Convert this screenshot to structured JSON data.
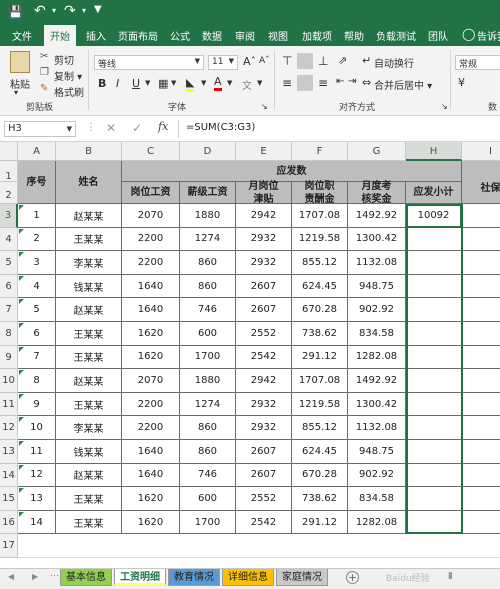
{
  "tabs": [
    "文件",
    "开始",
    "插入",
    "页面布局",
    "公式",
    "数据",
    "审阅",
    "视图",
    "加载项",
    "帮助",
    "负载测试",
    "团队",
    "告诉我"
  ],
  "ribbon": {
    "paste": "粘贴",
    "cut": "剪切",
    "copy": "复制 ▾",
    "format_painter": "格式刷",
    "clipboard": "剪贴板",
    "font_name": "等线",
    "font_size": "11",
    "font_group": "字体",
    "wrap": "自动换行",
    "merge": "合并后居中 ▾",
    "align_group": "对齐方式",
    "number_format": "常规",
    "number_group": "数"
  },
  "namebox": "H3",
  "formula": "=SUM(C3:G3)",
  "columns": [
    "A",
    "B",
    "C",
    "D",
    "E",
    "F",
    "G",
    "H",
    "I"
  ],
  "header": {
    "group": "应发数",
    "seq": "序号",
    "name": "姓名",
    "c": "岗位工资",
    "d": "薪级工资",
    "e": [
      "月岗位",
      "津贴"
    ],
    "f": [
      "岗位职",
      "责酬金"
    ],
    "g": [
      "月度考",
      "核奖金"
    ],
    "h": "应发小计",
    "i": "社保"
  },
  "rows": [
    {
      "n": "1",
      "name": "赵某某",
      "c": "2070",
      "d": "1880",
      "e": "2942",
      "f": "1707.08",
      "g": "1492.92",
      "h": "10092"
    },
    {
      "n": "2",
      "name": "王某某",
      "c": "2200",
      "d": "1274",
      "e": "2932",
      "f": "1219.58",
      "g": "1300.42",
      "h": ""
    },
    {
      "n": "3",
      "name": "李某某",
      "c": "2200",
      "d": "860",
      "e": "2932",
      "f": "855.12",
      "g": "1132.08",
      "h": ""
    },
    {
      "n": "4",
      "name": "钱某某",
      "c": "1640",
      "d": "860",
      "e": "2607",
      "f": "624.45",
      "g": "948.75",
      "h": ""
    },
    {
      "n": "5",
      "name": "赵某某",
      "c": "1640",
      "d": "746",
      "e": "2607",
      "f": "670.28",
      "g": "902.92",
      "h": ""
    },
    {
      "n": "6",
      "name": "王某某",
      "c": "1620",
      "d": "600",
      "e": "2552",
      "f": "738.62",
      "g": "834.58",
      "h": ""
    },
    {
      "n": "7",
      "name": "王某某",
      "c": "1620",
      "d": "1700",
      "e": "2542",
      "f": "291.12",
      "g": "1282.08",
      "h": ""
    },
    {
      "n": "8",
      "name": "赵某某",
      "c": "2070",
      "d": "1880",
      "e": "2942",
      "f": "1707.08",
      "g": "1492.92",
      "h": ""
    },
    {
      "n": "9",
      "name": "王某某",
      "c": "2200",
      "d": "1274",
      "e": "2932",
      "f": "1219.58",
      "g": "1300.42",
      "h": ""
    },
    {
      "n": "10",
      "name": "李某某",
      "c": "2200",
      "d": "860",
      "e": "2932",
      "f": "855.12",
      "g": "1132.08",
      "h": ""
    },
    {
      "n": "11",
      "name": "钱某某",
      "c": "1640",
      "d": "860",
      "e": "2607",
      "f": "624.45",
      "g": "948.75",
      "h": ""
    },
    {
      "n": "12",
      "name": "赵某某",
      "c": "1640",
      "d": "746",
      "e": "2607",
      "f": "670.28",
      "g": "902.92",
      "h": ""
    },
    {
      "n": "13",
      "name": "王某某",
      "c": "1620",
      "d": "600",
      "e": "2552",
      "f": "738.62",
      "g": "834.58",
      "h": ""
    },
    {
      "n": "14",
      "name": "王某某",
      "c": "1620",
      "d": "1700",
      "e": "2542",
      "f": "291.12",
      "g": "1282.08",
      "h": ""
    }
  ],
  "row_numbers": [
    "1",
    "2",
    "3",
    "4",
    "5",
    "6",
    "7",
    "8",
    "9",
    "10",
    "11",
    "12",
    "13",
    "14",
    "15",
    "16",
    "17"
  ],
  "sheets": [
    {
      "label": "基本信息",
      "color": "#92d050"
    },
    {
      "label": "工资明细",
      "color": "#ffff66"
    },
    {
      "label": "教育情况",
      "color": "#5b9bd5"
    },
    {
      "label": "详细信息",
      "color": "#ffc000"
    },
    {
      "label": "家庭情况",
      "color": "#c9c9c9"
    }
  ],
  "watermark": "Baidu经验"
}
